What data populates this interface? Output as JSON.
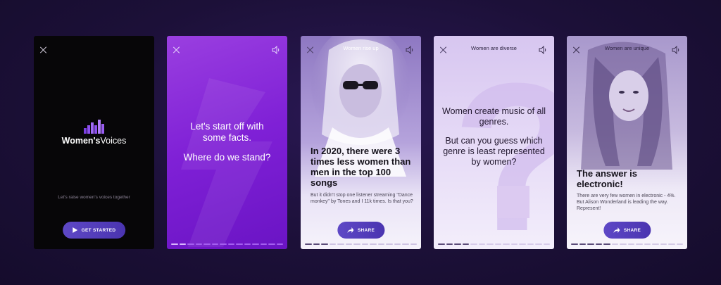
{
  "card1": {
    "app_name_part1": "Women's",
    "app_name_part2": "Voices",
    "tagline": "Let's raise women's voices together",
    "cta_label": "GET STARTED"
  },
  "card2": {
    "line1": "Let's start off with",
    "line2": "some facts.",
    "line3": "Where do we stand?"
  },
  "card3": {
    "topic": "Women rise up",
    "headline": "In 2020, there were 3 times less women than men in the top 100 songs",
    "body": "But it didn't stop one listener streaming \"Dance monkey\" by Tones and I 11k times. Is that you?",
    "share_label": "SHARE"
  },
  "card4": {
    "topic": "Women are diverse",
    "line1": "Women create music of all genres.",
    "line2": "But can you guess which genre is least represented by women?"
  },
  "card5": {
    "topic": "Women are unique",
    "headline": "The answer is electronic!",
    "body": "There are very few women in electronic - 4%. But Alison Wonderland is leading the way. Represent!",
    "share_label": "SHARE"
  },
  "progress": {
    "card1": 0,
    "card2": 0.12,
    "card3": 0.2,
    "card4": 0.28,
    "card5": 0.36
  },
  "colors": {
    "accent": "#5e48c6",
    "purple": "#8a2ce0"
  }
}
